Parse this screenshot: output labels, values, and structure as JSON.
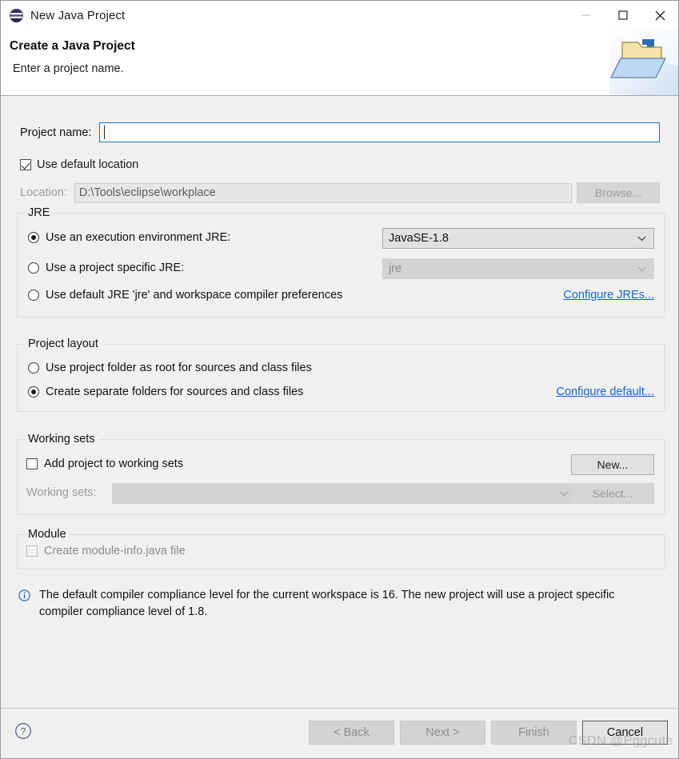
{
  "window": {
    "title": "New Java Project",
    "app_icon": "eclipse-icon",
    "controls": {
      "minimize": "minimize-icon",
      "maximize": "maximize-icon",
      "close": "close-icon"
    }
  },
  "header": {
    "title": "Create a Java Project",
    "subtitle": "Enter a project name.",
    "banner_icon": "java-project-folder-icon"
  },
  "form": {
    "project_name_label": "Project name:",
    "project_name_value": "",
    "use_default_location_label": "Use default location",
    "use_default_location_checked": true,
    "location_label": "Location:",
    "location_value": "D:\\Tools\\eclipse\\workplace",
    "browse_label": "Browse..."
  },
  "jre": {
    "group_title": "JRE",
    "options": [
      {
        "label": "Use an execution environment JRE:",
        "selected": true
      },
      {
        "label": "Use a project specific JRE:",
        "selected": false
      },
      {
        "label": "Use default JRE 'jre' and workspace compiler preferences",
        "selected": false
      }
    ],
    "execution_env_value": "JavaSE-1.8",
    "specific_jre_value": "jre",
    "configure_link": "Configure JREs..."
  },
  "project_layout": {
    "group_title": "Project layout",
    "options": [
      {
        "label": "Use project folder as root for sources and class files",
        "selected": false
      },
      {
        "label": "Create separate folders for sources and class files",
        "selected": true
      }
    ],
    "configure_link": "Configure default..."
  },
  "working_sets": {
    "group_title": "Working sets",
    "add_label": "Add project to working sets",
    "add_checked": false,
    "sets_label": "Working sets:",
    "sets_value": "",
    "new_label": "New...",
    "select_label": "Select..."
  },
  "module": {
    "group_title": "Module",
    "create_module_info_label": "Create module-info.java file",
    "create_module_info_checked": false
  },
  "info": {
    "icon": "info-icon",
    "message": "The default compiler compliance level for the current workspace is 16. The new project will use a project specific compiler compliance level of 1.8."
  },
  "footer": {
    "help_icon": "help-icon",
    "buttons": [
      {
        "label": "< Back",
        "enabled": false
      },
      {
        "label": "Next >",
        "enabled": false
      },
      {
        "label": "Finish",
        "enabled": false
      },
      {
        "label": "Cancel",
        "enabled": true
      }
    ]
  },
  "watermark": "CSDN @Pggcute",
  "colors": {
    "accent": "#1268c3",
    "focus_border": "#1176c4",
    "window_bg": "#f0f0f0"
  }
}
